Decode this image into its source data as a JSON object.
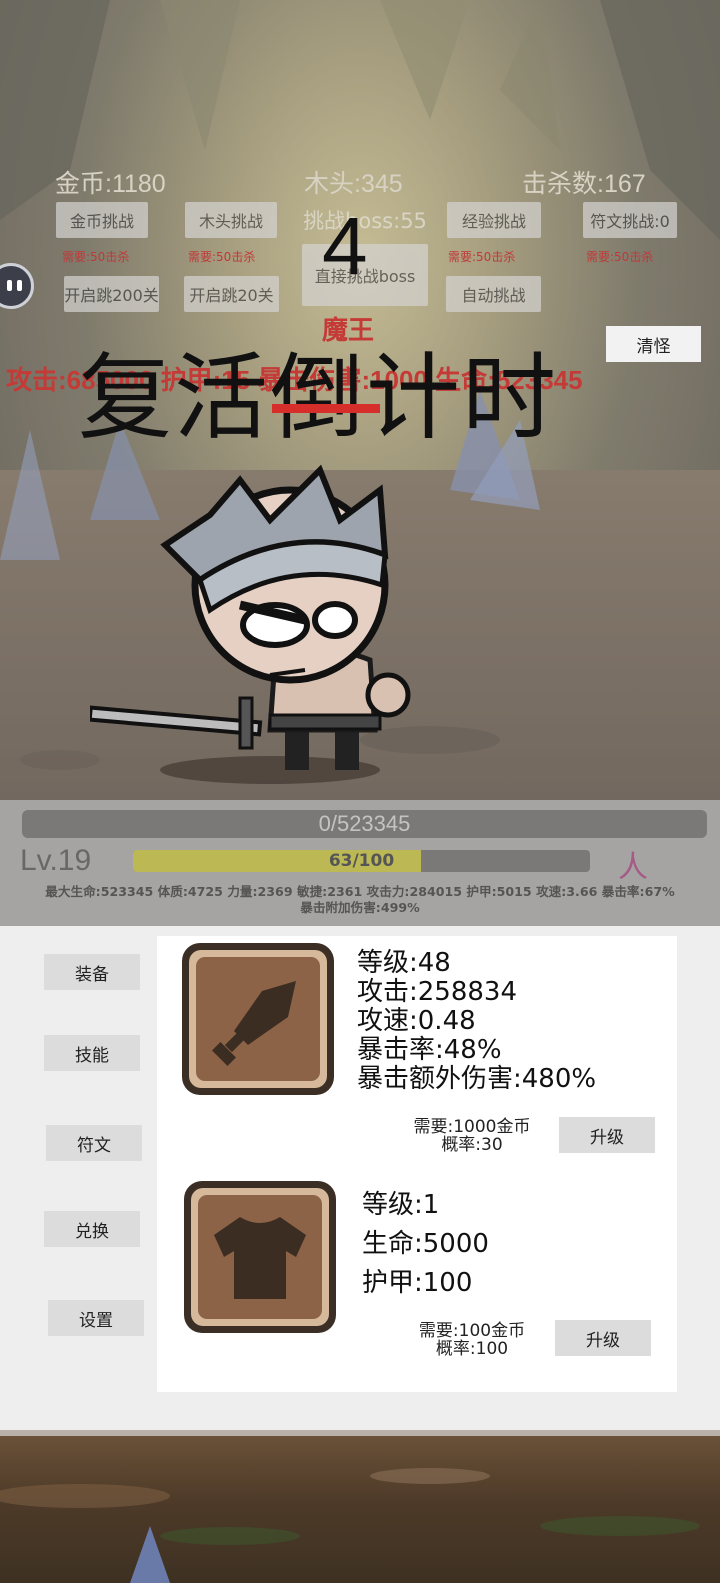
{
  "top_stats": {
    "gold": "金币:1180",
    "wood": "木头:345",
    "kills": "击杀数:167"
  },
  "challenges": {
    "gold_challenge": "金币挑战",
    "wood_challenge": "木头挑战",
    "boss_challenge": "挑战boss:55",
    "exp_challenge": "经验挑战",
    "rune_challenge": "符文挑战:0",
    "skip_200": "开启跳200关",
    "skip_20": "开启跳20关",
    "direct_boss": "直接挑战boss",
    "auto_challenge": "自动挑战",
    "need_left": "需要:50击杀",
    "need_mid": "需要:50击杀",
    "need_boss": "需要:50击杀",
    "need_right": "需要:50击杀"
  },
  "boss": {
    "name": "魔王",
    "stats_line": "攻击:685000  护甲:15 暴击伤害:1000  生命:523345"
  },
  "countdown": {
    "number": "4",
    "label": "复活倒计时"
  },
  "clear_button": "清怪",
  "hud": {
    "hp_text": "0/523345",
    "level": "Lv.19",
    "xp_text": "63/100",
    "xp_fraction": 0.63,
    "person_icon": "人",
    "stats_line1": "最大生命:523345 体质:4725 力量:2369 敏捷:2361 攻击力:284015 护甲:5015 攻速:3.66 暴击率:67%",
    "stats_line2": "暴击附加伤害:499%"
  },
  "sidebar": [
    "装备",
    "技能",
    "符文",
    "兑换",
    "设置"
  ],
  "equipment": [
    {
      "icon": "sword-icon",
      "lines": [
        "等级:48",
        "攻击:258834",
        "攻速:0.48",
        "暴击率:48%",
        "暴击额外伤害:480%"
      ],
      "need": "需要:1000金币",
      "rate": "概率:30",
      "button": "升级"
    },
    {
      "icon": "shirt-icon",
      "lines": [
        "等级:1",
        "生命:5000",
        "护甲:100"
      ],
      "need": "需要:100金币",
      "rate": "概率:100",
      "button": "升级"
    }
  ],
  "colors": {
    "accent_red": "#d62e2a",
    "xp_fill": "#bcb955",
    "icon_brown": "#8d6347"
  }
}
